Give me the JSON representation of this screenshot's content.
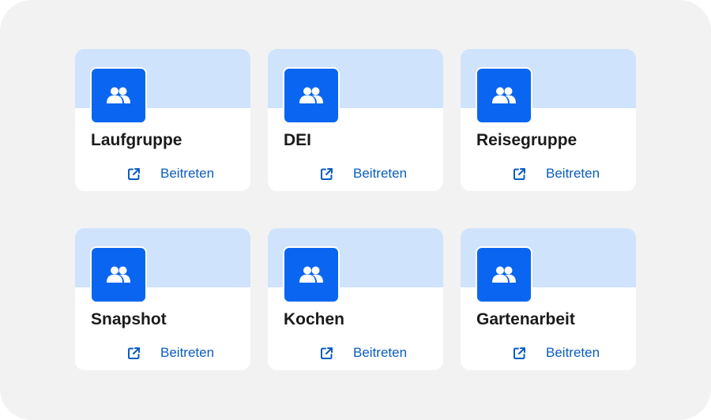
{
  "groups": [
    {
      "name": "Laufgruppe",
      "action_label": "Beitreten",
      "icon": "group-icon"
    },
    {
      "name": "DEI",
      "action_label": "Beitreten",
      "icon": "group-icon"
    },
    {
      "name": "Reisegruppe",
      "action_label": "Beitreten",
      "icon": "group-icon"
    },
    {
      "name": "Snapshot",
      "action_label": "Beitreten",
      "icon": "group-icon"
    },
    {
      "name": "Kochen",
      "action_label": "Beitreten",
      "icon": "group-icon"
    },
    {
      "name": "Gartenarbeit",
      "action_label": "Beitreten",
      "icon": "group-icon"
    }
  ],
  "colors": {
    "accent": "#0a66f0",
    "banner": "#d0e3fc",
    "link": "#0a5cc2",
    "background": "#f2f2f2"
  }
}
